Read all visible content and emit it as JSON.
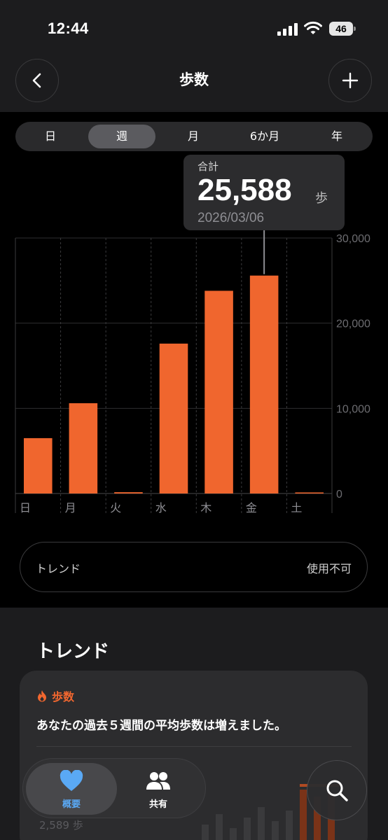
{
  "status": {
    "time": "12:44",
    "battery": "46"
  },
  "nav": {
    "title": "歩数"
  },
  "segments": [
    "日",
    "週",
    "月",
    "6か月",
    "年"
  ],
  "selected_segment": "週",
  "tooltip": {
    "label": "合計",
    "value": "25,588",
    "unit": "歩",
    "date": "2026/03/06"
  },
  "chart_data": {
    "type": "bar",
    "categories": [
      "日",
      "月",
      "火",
      "水",
      "木",
      "金",
      "土"
    ],
    "values": [
      6500,
      10600,
      150,
      17600,
      23800,
      25588,
      60
    ],
    "ylim": [
      0,
      30000
    ],
    "yticks": [
      "0",
      "10,000",
      "20,000",
      "30,000"
    ],
    "highlighted": "金",
    "color": "#f0662e",
    "grid": true
  },
  "trend_pill": {
    "label": "トレンド",
    "value": "使用不可"
  },
  "trends": {
    "heading": "トレンド",
    "card": {
      "tag": "歩数",
      "text": "あなたの過去５週間の平均歩数は増えました。",
      "faint_value": "2,589 歩"
    }
  },
  "tabs": [
    {
      "label": "概要",
      "icon": "heart-icon",
      "active": true
    },
    {
      "label": "共有",
      "icon": "people-icon",
      "active": false
    }
  ],
  "colors": {
    "accent": "#f0662e",
    "tab_active": "#5aa9f5"
  }
}
